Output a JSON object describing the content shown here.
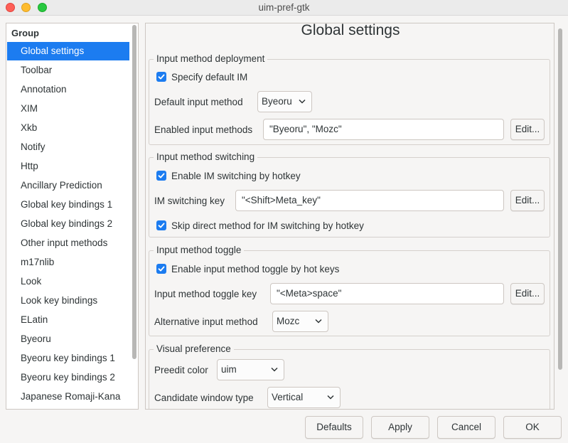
{
  "window": {
    "title": "uim-pref-gtk"
  },
  "sidebar": {
    "header": "Group",
    "items": [
      {
        "label": "Global settings",
        "selected": true
      },
      {
        "label": "Toolbar"
      },
      {
        "label": "Annotation"
      },
      {
        "label": "XIM"
      },
      {
        "label": "Xkb"
      },
      {
        "label": "Notify"
      },
      {
        "label": "Http"
      },
      {
        "label": "Ancillary Prediction"
      },
      {
        "label": "Global key bindings 1"
      },
      {
        "label": "Global key bindings 2"
      },
      {
        "label": "Other input methods"
      },
      {
        "label": "m17nlib"
      },
      {
        "label": "Look"
      },
      {
        "label": "Look key bindings"
      },
      {
        "label": "ELatin"
      },
      {
        "label": "Byeoru"
      },
      {
        "label": "Byeoru key bindings 1"
      },
      {
        "label": "Byeoru key bindings 2"
      },
      {
        "label": "Japanese Romaji-Kana"
      }
    ]
  },
  "main": {
    "title": "Global settings",
    "deployment": {
      "label": "Input method deployment",
      "specify_default_im": {
        "label": "Specify default IM",
        "checked": true
      },
      "default_im_label": "Default input method",
      "default_im_value": "Byeoru",
      "enabled_label": "Enabled input methods",
      "enabled_value": "\"Byeoru\", \"Mozc\"",
      "edit_label": "Edit..."
    },
    "switching": {
      "label": "Input method switching",
      "enable_hotkey": {
        "label": "Enable IM switching by hotkey",
        "checked": true
      },
      "key_label": "IM switching key",
      "key_value": "\"<Shift>Meta_key\"",
      "edit_label": "Edit...",
      "skip_direct": {
        "label": "Skip direct method for IM switching by hotkey",
        "checked": true
      }
    },
    "toggle": {
      "label": "Input method toggle",
      "enable_toggle": {
        "label": "Enable input method toggle by hot keys",
        "checked": true
      },
      "key_label": "Input method toggle key",
      "key_value": "\"<Meta>space\"",
      "edit_label": "Edit...",
      "alt_label": "Alternative input method",
      "alt_value": "Mozc"
    },
    "visual": {
      "label": "Visual preference",
      "preedit_label": "Preedit color",
      "preedit_value": "uim",
      "candidate_label": "Candidate window type",
      "candidate_value": "Vertical"
    }
  },
  "buttons": {
    "defaults": "Defaults",
    "apply": "Apply",
    "cancel": "Cancel",
    "ok": "OK"
  },
  "colors": {
    "accent": "#1c7cf0",
    "window_bg": "#f6f5f4"
  }
}
